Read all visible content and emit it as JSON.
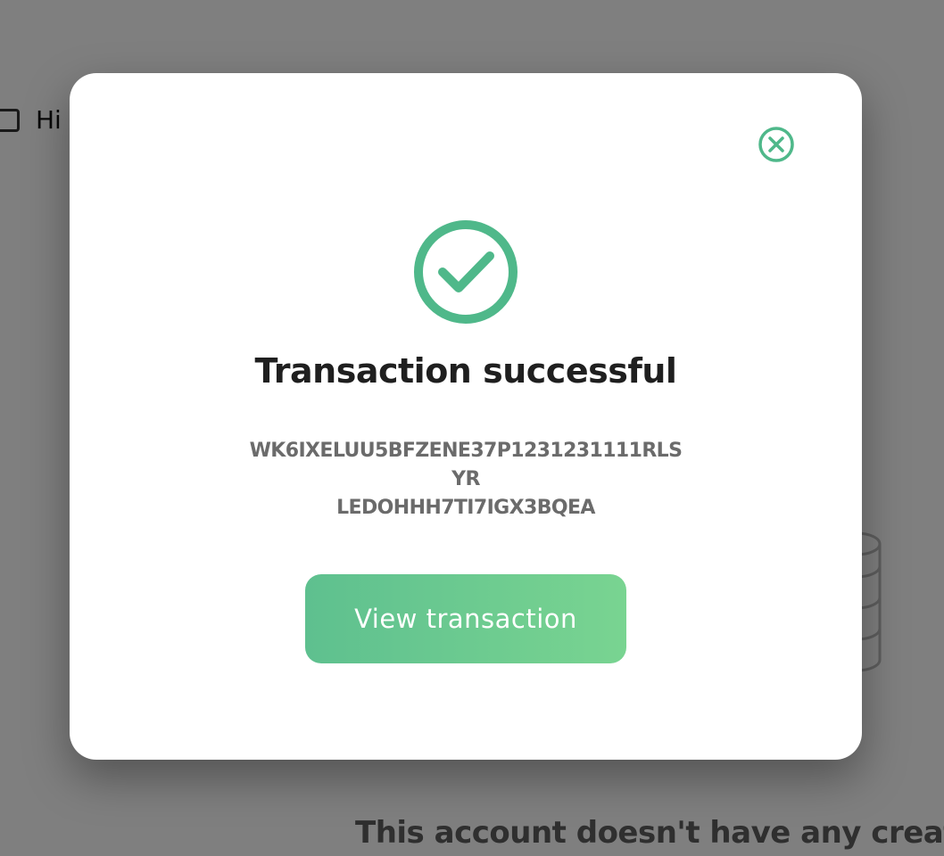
{
  "background": {
    "checkbox_label": "Hi",
    "empty_message": "This account doesn't have any create"
  },
  "modal": {
    "icon": "check-circle-icon",
    "close_icon": "close-circle-icon",
    "title": "Transaction successful",
    "hash_line1": "WK6IXELUU5BFZENE37P1231231111RLSYR",
    "hash_line2": "LEDOHHH7TI7IGX3BQEA",
    "button_label": "View transaction"
  },
  "colors": {
    "accent": "#4fb88a",
    "button_start": "#5ec08f",
    "button_end": "#79d491",
    "overlay": "rgba(0,0,0,0.5)"
  }
}
